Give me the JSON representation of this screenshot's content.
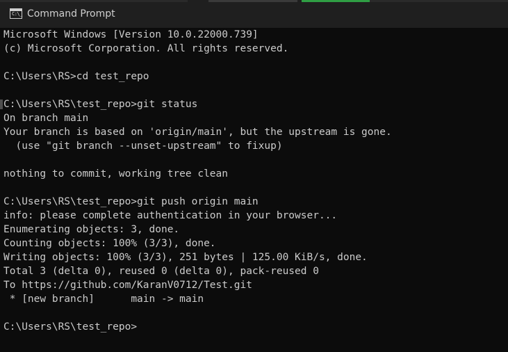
{
  "window": {
    "title": "Command Prompt",
    "icon_label": "C:\\_"
  },
  "console": {
    "lines": [
      "Microsoft Windows [Version 10.0.22000.739]",
      "(c) Microsoft Corporation. All rights reserved.",
      "",
      "C:\\Users\\RS>cd test_repo",
      "",
      "C:\\Users\\RS\\test_repo>git status",
      "On branch main",
      "Your branch is based on 'origin/main', but the upstream is gone.",
      "  (use \"git branch --unset-upstream\" to fixup)",
      "",
      "nothing to commit, working tree clean",
      "",
      "C:\\Users\\RS\\test_repo>git push origin main",
      "info: please complete authentication in your browser...",
      "Enumerating objects: 3, done.",
      "Counting objects: 100% (3/3), done.",
      "Writing objects: 100% (3/3), 251 bytes | 125.00 KiB/s, done.",
      "Total 3 (delta 0), reused 0 (delta 0), pack-reused 0",
      "To https://github.com/KaranV0712/Test.git",
      " * [new branch]      main -> main",
      "",
      "C:\\Users\\RS\\test_repo>"
    ]
  },
  "colors": {
    "background": "#0c0c0c",
    "titlebar": "#1f1f1f",
    "text": "#cccccc",
    "accent": "#2f9e44"
  }
}
